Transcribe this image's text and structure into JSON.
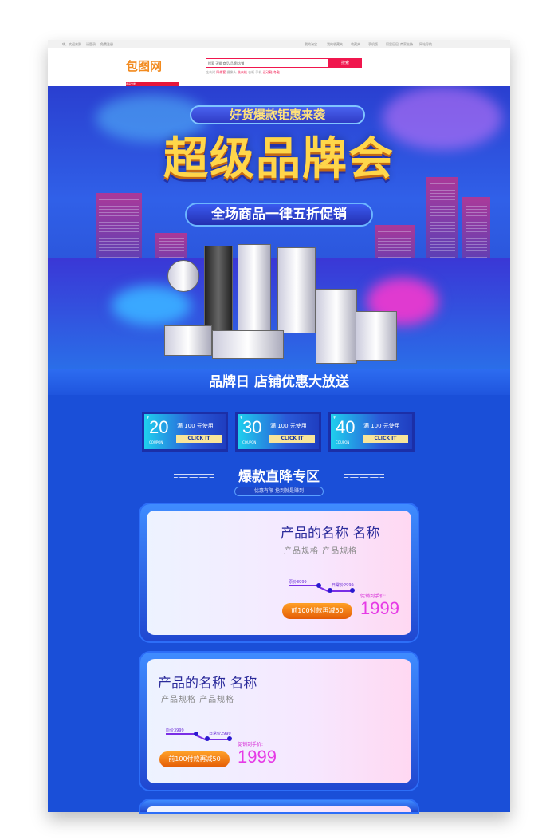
{
  "topbar": {
    "left_links": [
      "嗨，欢迎来到",
      "请登录",
      "免费注册"
    ],
    "right_links": [
      "我的淘宝",
      "我的收藏夹",
      "收藏夹",
      "手机版",
      "阿里巴巴",
      "商家支持",
      "网站导航"
    ]
  },
  "header": {
    "logo": "包图网",
    "search_placeholder": "搜索 天猫 商品/品牌/店铺",
    "search_button": "搜索",
    "hot_words": [
      "连衣裙",
      "四件套",
      "摄像头",
      "洗衣机",
      "衣柜",
      "手机",
      "运动鞋",
      "冬鞋"
    ],
    "nav_category": "商品分类"
  },
  "hero": {
    "tagline": "好货爆款钜惠来袭",
    "title": "超级品牌会",
    "subtitle": "全场商品一律五折促销"
  },
  "strip": {
    "text": "品牌日 店铺优惠大放送"
  },
  "coupons": [
    {
      "currency": "¥",
      "amount": "20",
      "label": "COUPON",
      "rule": "满 100 元使用",
      "button": "CLICK IT"
    },
    {
      "currency": "¥",
      "amount": "30",
      "label": "COUPON",
      "rule": "满 100 元使用",
      "button": "CLICK IT"
    },
    {
      "currency": "¥",
      "amount": "40",
      "label": "COUPON",
      "rule": "满 100 元使用",
      "button": "CLICK IT"
    }
  ],
  "section": {
    "title": "爆款直降专区",
    "subtitle": "优惠有限 抢到就是赚到"
  },
  "products": [
    {
      "name": "产品的名称 名称",
      "spec": "产品规格 产品规格",
      "original_price": "原价3999",
      "daily_price": "日常价2999",
      "promo_label": "促销到手价:",
      "price": "1999",
      "button": "前100付款再减50"
    },
    {
      "name": "产品的名称 名称",
      "spec": "产品规格 产品规格",
      "original_price": "原价3999",
      "daily_price": "日常价2999",
      "promo_label": "促销到手价:",
      "price": "1999",
      "button": "前100付款再减50"
    }
  ]
}
